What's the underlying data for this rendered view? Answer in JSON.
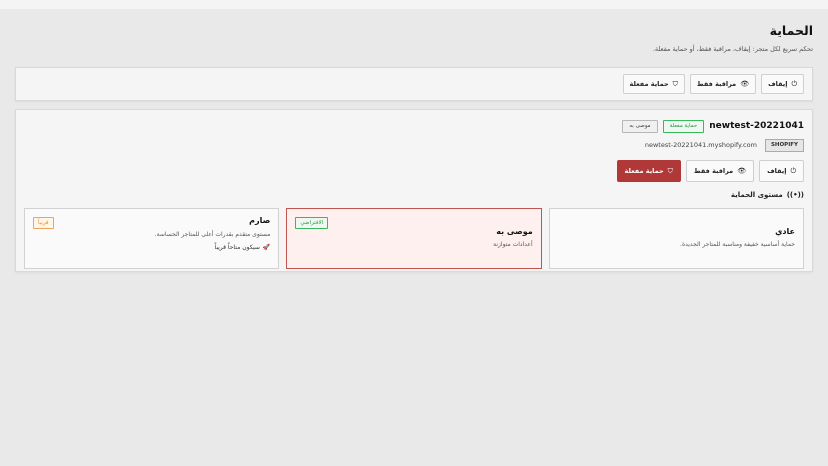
{
  "header": {
    "title": "الحماية",
    "subtitle": "تحكم سريع لكل متجر: إيقاف، مراقبة فقط، أو حماية مفعلة."
  },
  "toolbar": {
    "stop_label": "إيقاف",
    "monitor_label": "مراقبة فقط",
    "enable_label": "حماية مفعلة"
  },
  "store": {
    "name": "newtest-20221041",
    "status_badge": "حماية مفعلة",
    "recommended_badge": "موصى به",
    "platform": "SHOPIFY",
    "domain": "newtest-20221041.myshopify.com",
    "actions": {
      "stop_label": "إيقاف",
      "monitor_label": "مراقبة فقط",
      "enable_label": "حماية مفعلة"
    },
    "section_title": "مستوى الحماية"
  },
  "levels": [
    {
      "name": "عادي",
      "description": "حماية أساسية خفيفة ومناسبة للمتاجر الجديدة."
    },
    {
      "name": "موصى به",
      "description": "أعدادات متوازنة",
      "tag": "الافتراضي"
    },
    {
      "name": "صارم",
      "description": "مستوى متقدم بقدرات أعلى للمتاجر الحساسة.",
      "note": "سيكون متاحاً قريباً",
      "tag": "قريباً"
    }
  ],
  "colors": {
    "accent_red": "#b03838",
    "success_green": "#3bb85e",
    "warning_orange": "#eea25a"
  },
  "icons": {
    "stop": "power-icon",
    "monitor": "eye-icon",
    "enable": "shield-icon",
    "section": "radio-icon",
    "soon": "rocket-icon"
  }
}
